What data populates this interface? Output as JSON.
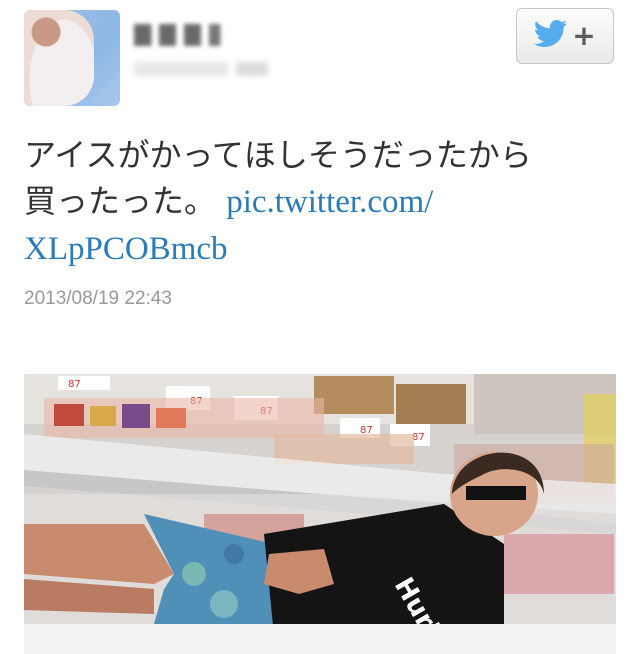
{
  "author": {
    "avatar": "user-avatar",
    "display_name": "",
    "handle": ""
  },
  "follow_button": {
    "icon": "twitter-bird-icon",
    "symbol": "+"
  },
  "tweet": {
    "text_line_1": "アイスがかってほしそうだったから",
    "text_line_2": "買ったった。",
    "link_part_1": "pic.twitter.com/",
    "link_part_2": "XLpPCOBmcb",
    "timestamp": "2013/08/19 22:43"
  },
  "media": {
    "price_tags": [
      "87",
      "87",
      "87",
      "87",
      "87"
    ],
    "shirt_text": "Hurley",
    "colors": {
      "link": "#2b7bb9",
      "twitter_blue": "#55acee"
    }
  }
}
